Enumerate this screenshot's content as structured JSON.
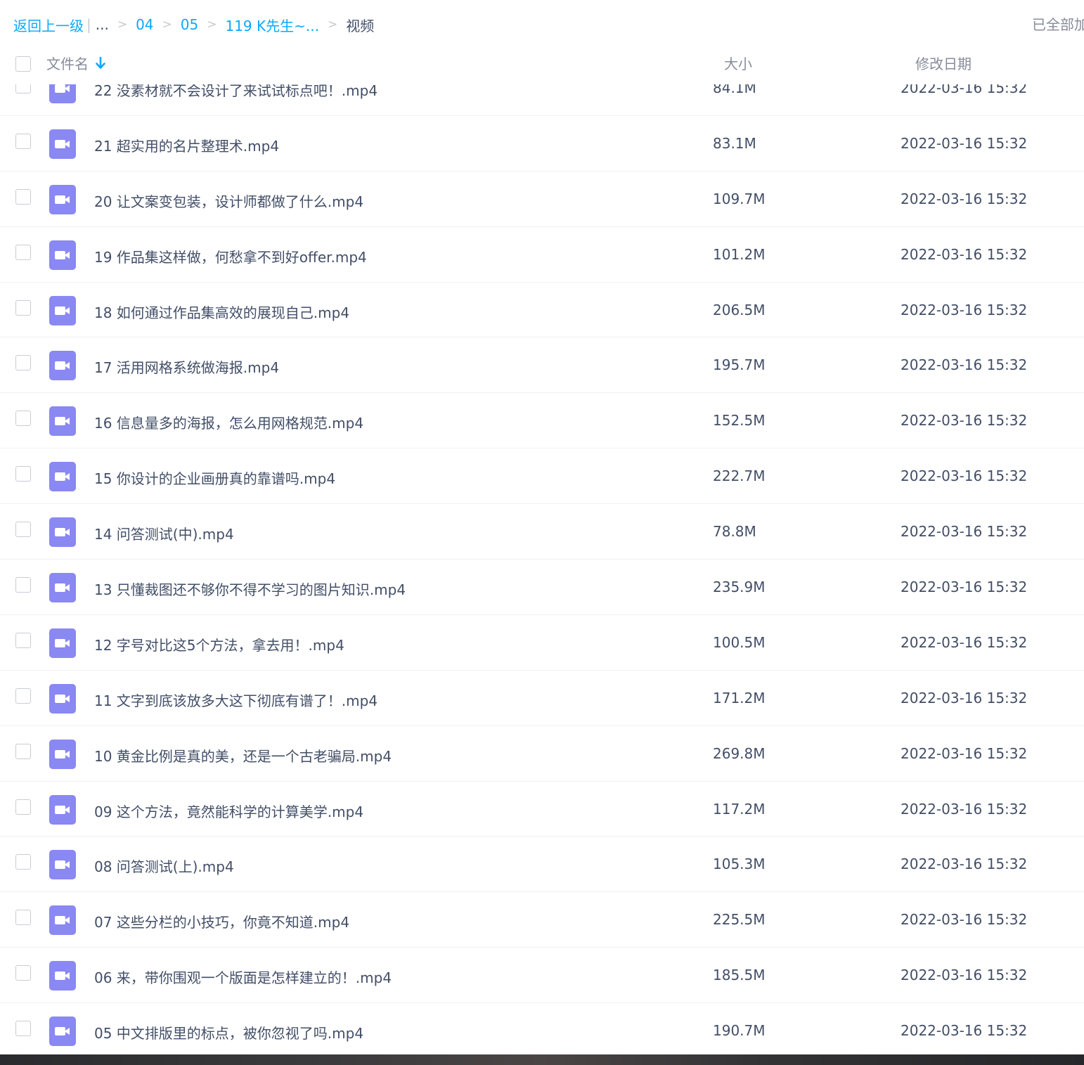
{
  "breadcrumb": {
    "back": "返回上一级",
    "divider": "|",
    "ellipsis": "...",
    "sep": ">",
    "items": [
      "04",
      "05",
      "119 K先生~..."
    ],
    "current": "视频"
  },
  "status": {
    "loaded": "已全部加载"
  },
  "header": {
    "name": "文件名",
    "size": "大小",
    "date": "修改日期"
  },
  "colors": {
    "link": "#09aaff",
    "icon_bg": "#8a88f3",
    "text": "#424e67",
    "muted": "#878c9c"
  },
  "files": [
    {
      "name": "22 没素材就不会设计了来试试标点吧！.mp4",
      "size": "84.1M",
      "date": "2022-03-16 15:32"
    },
    {
      "name": "21 超实用的名片整理术.mp4",
      "size": "83.1M",
      "date": "2022-03-16 15:32"
    },
    {
      "name": "20 让文案变包装，设计师都做了什么.mp4",
      "size": "109.7M",
      "date": "2022-03-16 15:32"
    },
    {
      "name": "19 作品集这样做，何愁拿不到好offer.mp4",
      "size": "101.2M",
      "date": "2022-03-16 15:32"
    },
    {
      "name": "18 如何通过作品集高效的展现自己.mp4",
      "size": "206.5M",
      "date": "2022-03-16 15:32"
    },
    {
      "name": "17 活用网格系统做海报.mp4",
      "size": "195.7M",
      "date": "2022-03-16 15:32"
    },
    {
      "name": "16 信息量多的海报，怎么用网格规范.mp4",
      "size": "152.5M",
      "date": "2022-03-16 15:32"
    },
    {
      "name": "15 你设计的企业画册真的靠谱吗.mp4",
      "size": "222.7M",
      "date": "2022-03-16 15:32"
    },
    {
      "name": "14 问答测试(中).mp4",
      "size": "78.8M",
      "date": "2022-03-16 15:32"
    },
    {
      "name": "13 只懂裁图还不够你不得不学习的图片知识.mp4",
      "size": "235.9M",
      "date": "2022-03-16 15:32"
    },
    {
      "name": "12 字号对比这5个方法，拿去用！.mp4",
      "size": "100.5M",
      "date": "2022-03-16 15:32"
    },
    {
      "name": "11 文字到底该放多大这下彻底有谱了！.mp4",
      "size": "171.2M",
      "date": "2022-03-16 15:32"
    },
    {
      "name": "10 黄金比例是真的美，还是一个古老骗局.mp4",
      "size": "269.8M",
      "date": "2022-03-16 15:32"
    },
    {
      "name": "09 这个方法，竟然能科学的计算美学.mp4",
      "size": "117.2M",
      "date": "2022-03-16 15:32"
    },
    {
      "name": "08 问答测试(上).mp4",
      "size": "105.3M",
      "date": "2022-03-16 15:32"
    },
    {
      "name": "07 这些分栏的小技巧，你竟不知道.mp4",
      "size": "225.5M",
      "date": "2022-03-16 15:32"
    },
    {
      "name": "06 来，带你围观一个版面是怎样建立的！.mp4",
      "size": "185.5M",
      "date": "2022-03-16 15:32"
    },
    {
      "name": "05 中文排版里的标点，被你忽视了吗.mp4",
      "size": "190.7M",
      "date": "2022-03-16 15:32"
    }
  ]
}
